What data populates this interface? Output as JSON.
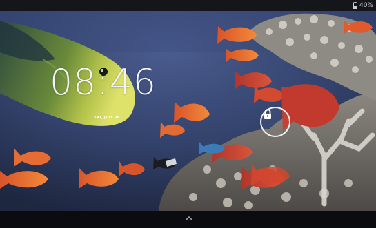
{
  "status_bar": {
    "battery_text": "40%",
    "icons": {
      "battery": "battery-icon"
    }
  },
  "lock_screen": {
    "time": "08:46",
    "date": "SAT, JULY 26",
    "unlock_icon": "lock-icon"
  },
  "navigation": {
    "chevron_icon": "chevron-up-icon"
  },
  "colors": {
    "ocean": "#33426b",
    "coral": "#6e6a66",
    "clock_text": "#f2f4f7",
    "status_bar": "#14161a",
    "nav_bar": "#0b0c10"
  }
}
